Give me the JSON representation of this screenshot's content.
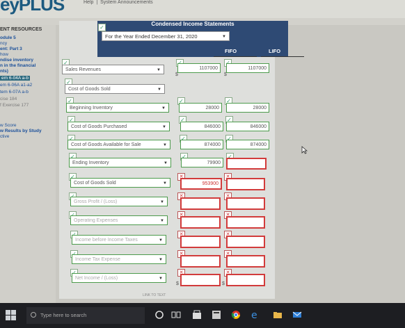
{
  "header": {
    "logo_text": "eyPLUS",
    "links": [
      "Help",
      "|",
      "System Announcements"
    ]
  },
  "sidebar": {
    "title": "ENT RESOURCES",
    "items": [
      {
        "label": "odule 5",
        "style": "b"
      },
      {
        "label": "ncy",
        "style": ""
      },
      {
        "label": "ent: Part 3",
        "style": "b"
      },
      {
        "label": "how",
        "style": ""
      },
      {
        "label": "ndise inventory",
        "style": "b"
      },
      {
        "label": "n in the financial",
        "style": "b"
      },
      {
        "label": "nts)",
        "style": "b"
      },
      {
        "label": "em 6-04A a-b",
        "style": "hl"
      },
      {
        "label": "em 6-06A a1-a2",
        "style": ""
      },
      {
        "label": "tem 6-07A a-b",
        "style": ""
      },
      {
        "label": "cise 184",
        "style": "gray"
      },
      {
        "label": "f Exercise 177",
        "style": "gray"
      },
      {
        "label": "w Score",
        "style": ""
      },
      {
        "label": "w Results by Study",
        "style": "b"
      },
      {
        "label": "ctive",
        "style": ""
      }
    ]
  },
  "statement": {
    "title": "Condensed Income Statements",
    "period": "For the Year Ended December 31, 2020",
    "col_fifo": "FIFO",
    "col_lifo": "LIFO",
    "currency": "$",
    "rows": [
      {
        "label": "Sales Revenues",
        "fifo": "1107000",
        "lifo": "1107000"
      },
      {
        "label": "Cost of Goods Sold",
        "fifo": "",
        "lifo": ""
      },
      {
        "label": "Beginning Inventory",
        "fifo": "28000",
        "lifo": "28000"
      },
      {
        "label": "Cost of Goods Purchased",
        "fifo": "846000",
        "lifo": "846000"
      },
      {
        "label": "Cost of Goods Available for Sale",
        "fifo": "874000",
        "lifo": "874000"
      },
      {
        "label": "Ending Inventory",
        "fifo": "79900",
        "lifo": ""
      },
      {
        "label": "Cost of Goods Sold",
        "fifo": "953900",
        "lifo": ""
      },
      {
        "label": "Gross Profit / (Loss)",
        "fifo": "",
        "lifo": ""
      },
      {
        "label": "Operating Expenses",
        "fifo": "",
        "lifo": ""
      },
      {
        "label": "Income before Income Taxes",
        "fifo": "",
        "lifo": ""
      },
      {
        "label": "Income Tax Expense",
        "fifo": "",
        "lifo": ""
      },
      {
        "label": "Net Income / (Loss)",
        "fifo": "",
        "lifo": ""
      }
    ],
    "link_text": "LINK TO TEXT"
  },
  "taskbar": {
    "search_placeholder": "Type here to search"
  },
  "colors": {
    "header_bg": "#2e4a74",
    "error_red": "#d23b3b",
    "ok_green": "#4c9b4c"
  }
}
